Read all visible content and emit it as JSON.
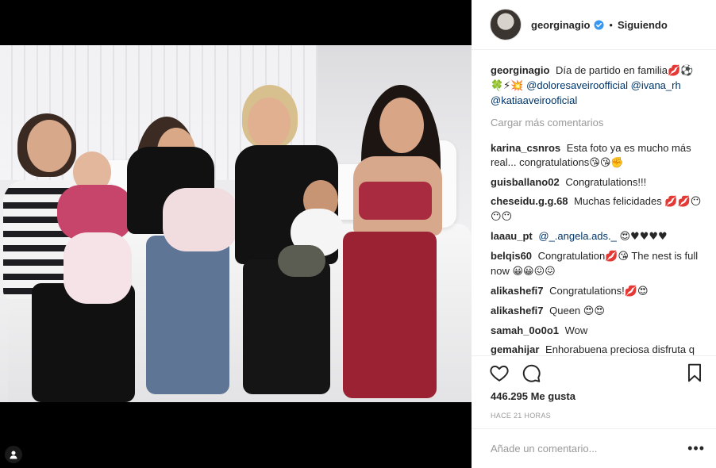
{
  "post": {
    "username": "georginagio",
    "follow_status": "Siguiendo",
    "separator": "•",
    "caption": {
      "text": "Día de partido en familia",
      "emoji_line": "🍀⚡💥",
      "mentions": [
        "@doloresaveiroofficial",
        "@ivana_rh",
        "@katiaaveirooficial"
      ]
    },
    "load_more": "Cargar más comentarios",
    "comments": [
      {
        "user": "karina_csnros",
        "text": "Esta foto ya es mucho más real... congratulations",
        "emoji": "😘😘✊"
      },
      {
        "user": "guisballano02",
        "text": "Congratulations!!!",
        "emoji": ""
      },
      {
        "user": "cheseidu.g.g.68",
        "text": "Muchas felicidades",
        "emoji": "💋💋😶😶😶"
      },
      {
        "user": "laaau_pt",
        "mention": "@_.angela.ads._",
        "emoji": "😍♥♥♥♥"
      },
      {
        "user": "belqis60",
        "text": "Congratulation",
        "text2": " The nest is full now",
        "emoji": "💋😘",
        "emoji2": "😀😀😖😖"
      },
      {
        "user": "alikashefi7",
        "text": "Congratulations!",
        "emoji": "💋😍"
      },
      {
        "user": "alikashefi7",
        "text": "Queen",
        "emoji": "😍😍"
      },
      {
        "user": "samah_0o0o1",
        "text": "Wow",
        "emoji": ""
      },
      {
        "user": "gemahijar",
        "text": "Enhorabuena preciosa disfruta q tiempo pasa rapidito",
        "emoji": "😍"
      }
    ],
    "likes": "446.295 Me gusta",
    "time_ago": "HACE 21 HORAS",
    "add_comment_placeholder": "Añade un comentario...",
    "more_options": "•••"
  }
}
